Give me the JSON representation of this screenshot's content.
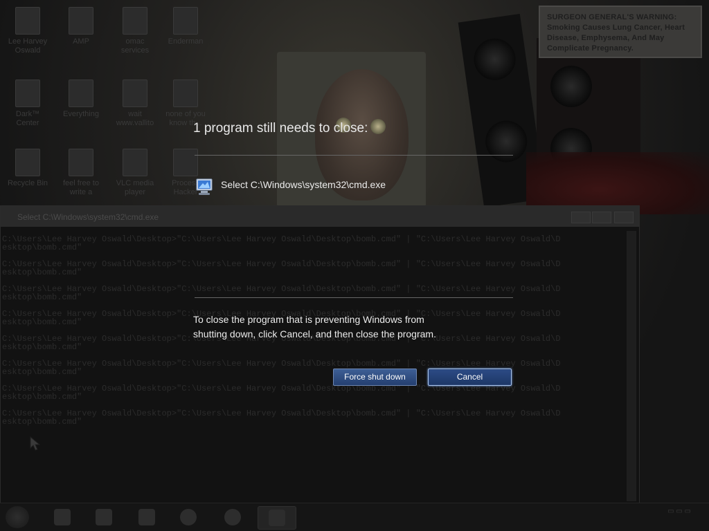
{
  "dialog": {
    "heading": "1 program still needs to close:",
    "program_name": "Select C:\\Windows\\system32\\cmd.exe",
    "explanation_line1": "To close the program that is preventing Windows from",
    "explanation_line2": "shutting down, click Cancel, and then close the program.",
    "force_label": "Force shut down",
    "cancel_label": "Cancel"
  },
  "desktop": {
    "icons": [
      {
        "label": "Lee Harvey Oswald",
        "icon": "user-icon"
      },
      {
        "label": "AMP",
        "icon": "app-icon"
      },
      {
        "label": "omac services",
        "icon": "app-icon"
      },
      {
        "label": "Enderman",
        "icon": "app-icon"
      },
      {
        "label": "Dark™ Center",
        "icon": "app-icon"
      },
      {
        "label": "Everything",
        "icon": "app-icon"
      },
      {
        "label": "wait www.vallito",
        "icon": "app-icon"
      },
      {
        "label": "none of you know th...",
        "icon": "app-icon"
      },
      {
        "label": "Recycle Bin",
        "icon": "recycle-bin-icon"
      },
      {
        "label": "feel free to write a",
        "icon": "file-icon"
      },
      {
        "label": "VLC media player",
        "icon": "vlc-icon"
      },
      {
        "label": "Process Hacker",
        "icon": "app-icon"
      }
    ],
    "warning_text": "SURGEON GENERAL'S WARNING: Smoking Causes Lung Cancer, Heart Disease, Emphysema, And May Complicate Pregnancy."
  },
  "cmd": {
    "title": "Select C:\\Windows\\system32\\cmd.exe",
    "lines": [
      "C:\\Users\\Lee Harvey Oswald\\Desktop>\"C:\\Users\\Lee Harvey Oswald\\Desktop\\bomb.cmd\" | \"C:\\Users\\Lee Harvey Oswald\\D",
      "esktop\\bomb.cmd\"",
      "",
      "C:\\Users\\Lee Harvey Oswald\\Desktop>\"C:\\Users\\Lee Harvey Oswald\\Desktop\\bomb.cmd\" | \"C:\\Users\\Lee Harvey Oswald\\D",
      "esktop\\bomb.cmd\"",
      "",
      "C:\\Users\\Lee Harvey Oswald\\Desktop>\"C:\\Users\\Lee Harvey Oswald\\Desktop\\bomb.cmd\" | \"C:\\Users\\Lee Harvey Oswald\\D",
      "esktop\\bomb.cmd\"",
      "",
      "C:\\Users\\Lee Harvey Oswald\\Desktop>\"C:\\Users\\Lee Harvey Oswald\\Desktop\\bomb.cmd\" | \"C:\\Users\\Lee Harvey Oswald\\D",
      "esktop\\bomb.cmd\"",
      "",
      "C:\\Users\\Lee Harvey Oswald\\Desktop>\"C:\\Users\\Lee Harvey Oswald\\Desktop\\bomb.cmd\" | \"C:\\Users\\Lee Harvey Oswald\\D",
      "esktop\\bomb.cmd\"",
      "",
      "C:\\Users\\Lee Harvey Oswald\\Desktop>\"C:\\Users\\Lee Harvey Oswald\\Desktop\\bomb.cmd\" | \"C:\\Users\\Lee Harvey Oswald\\D",
      "esktop\\bomb.cmd\"",
      "",
      "C:\\Users\\Lee Harvey Oswald\\Desktop>\"C:\\Users\\Lee Harvey Oswald\\Desktop\\bomb.cmd\" | \"C:\\Users\\Lee Harvey Oswald\\D",
      "esktop\\bomb.cmd\"",
      "",
      "C:\\Users\\Lee Harvey Oswald\\Desktop>\"C:\\Users\\Lee Harvey Oswald\\Desktop\\bomb.cmd\" | \"C:\\Users\\Lee Harvey Oswald\\D",
      "esktop\\bomb.cmd\""
    ]
  },
  "taskbar": {
    "items": [
      "start-orb-icon",
      "media-icon",
      "app-icon",
      "itunes-icon",
      "firefox-icon",
      "chrome-icon",
      "cmd-icon"
    ]
  },
  "colors": {
    "button_blue": "#2c4b86",
    "text": "#ececec"
  }
}
